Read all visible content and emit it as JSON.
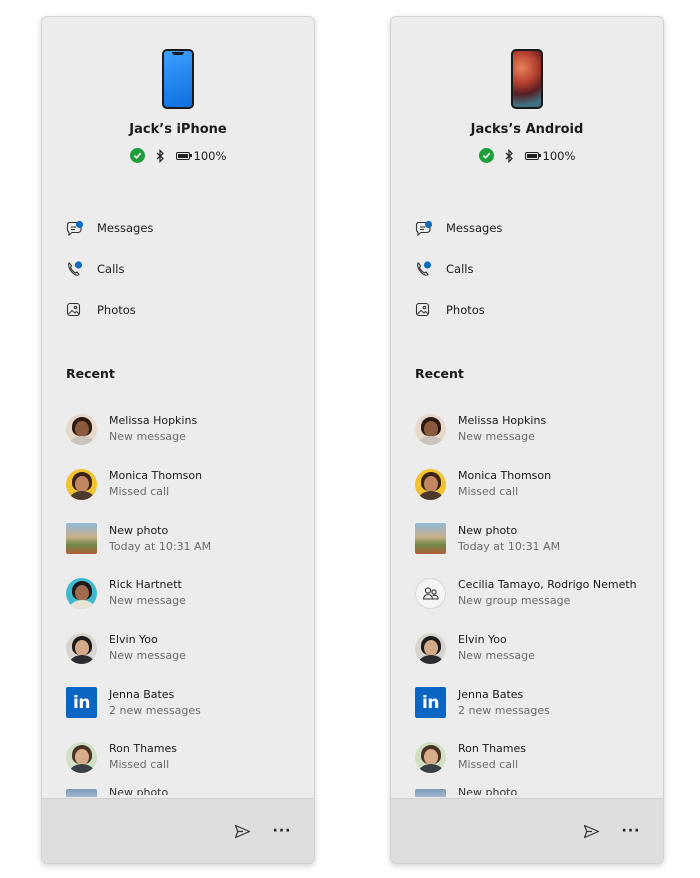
{
  "panels": [
    {
      "device_name": "Jack’s iPhone",
      "battery": "100%",
      "nav": {
        "messages": "Messages",
        "calls": "Calls",
        "photos": "Photos"
      },
      "recent_heading": "Recent",
      "recent": [
        {
          "title": "Melissa Hopkins",
          "subtitle": "New message",
          "avatar": "person"
        },
        {
          "title": "Monica Thomson",
          "subtitle": "Missed call",
          "avatar": "person"
        },
        {
          "title": "New photo",
          "subtitle": "Today at 10:31 AM",
          "avatar": "photo"
        },
        {
          "title": "Rick Hartnett",
          "subtitle": "New message",
          "avatar": "person"
        },
        {
          "title": "Elvin Yoo",
          "subtitle": "New message",
          "avatar": "person"
        },
        {
          "title": "Jenna Bates",
          "subtitle": "2 new messages",
          "avatar": "linkedin"
        },
        {
          "title": "Ron Thames",
          "subtitle": "Missed call",
          "avatar": "person"
        }
      ],
      "partial_item": "New photo"
    },
    {
      "device_name": "Jacks’s Android",
      "battery": "100%",
      "nav": {
        "messages": "Messages",
        "calls": "Calls",
        "photos": "Photos"
      },
      "recent_heading": "Recent",
      "recent": [
        {
          "title": "Melissa Hopkins",
          "subtitle": "New message",
          "avatar": "person"
        },
        {
          "title": "Monica Thomson",
          "subtitle": "Missed call",
          "avatar": "person"
        },
        {
          "title": "New photo",
          "subtitle": "Today at 10:31 AM",
          "avatar": "photo"
        },
        {
          "title": "Cecilia Tamayo, Rodrigo Nemeth",
          "subtitle": "New group message",
          "avatar": "group"
        },
        {
          "title": "Elvin Yoo",
          "subtitle": "New message",
          "avatar": "person"
        },
        {
          "title": "Jenna Bates",
          "subtitle": "2 new messages",
          "avatar": "linkedin"
        },
        {
          "title": "Ron Thames",
          "subtitle": "Missed call",
          "avatar": "person"
        }
      ],
      "partial_item": "New photo"
    }
  ],
  "linkedin_glyph": "in",
  "more_glyph": "···",
  "colors": {
    "panel_bg": "#ececec",
    "footer_bg": "#dedede",
    "accent": "#0f6cbd",
    "connected": "#1e9e3a",
    "linkedin": "#0a66c2"
  }
}
